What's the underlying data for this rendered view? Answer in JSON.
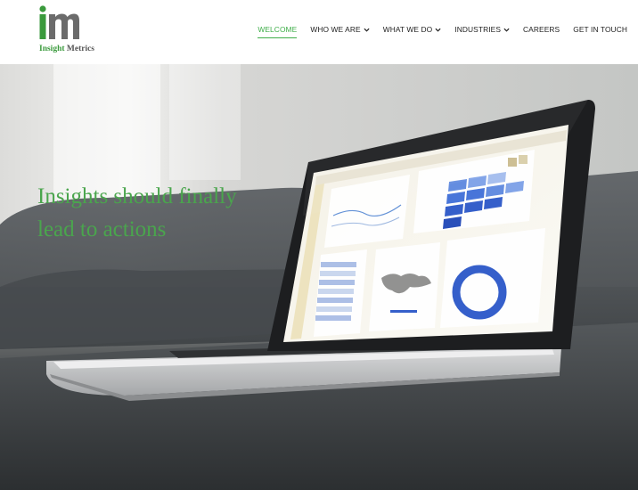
{
  "brand": {
    "logo_letters": "im",
    "name_part1": "Insight",
    "name_part2": "Metrics",
    "colors": {
      "green": "#3a9a3c",
      "gray": "#555555"
    }
  },
  "nav": {
    "items": [
      {
        "label": "WELCOME",
        "active": true,
        "has_dropdown": false
      },
      {
        "label": "WHO WE ARE",
        "active": false,
        "has_dropdown": true
      },
      {
        "label": "WHAT WE DO",
        "active": false,
        "has_dropdown": true
      },
      {
        "label": "INDUSTRIES",
        "active": false,
        "has_dropdown": true
      },
      {
        "label": "CAREERS",
        "active": false,
        "has_dropdown": false
      },
      {
        "label": "GET IN TOUCH",
        "active": false,
        "has_dropdown": false
      }
    ],
    "active_color": "#3fae49"
  },
  "hero": {
    "headline_line1": "Insights should finally",
    "headline_line2": "lead to actions",
    "headline_color": "#4aa54d",
    "image_description_icon": "laptop-dashboard-image"
  }
}
